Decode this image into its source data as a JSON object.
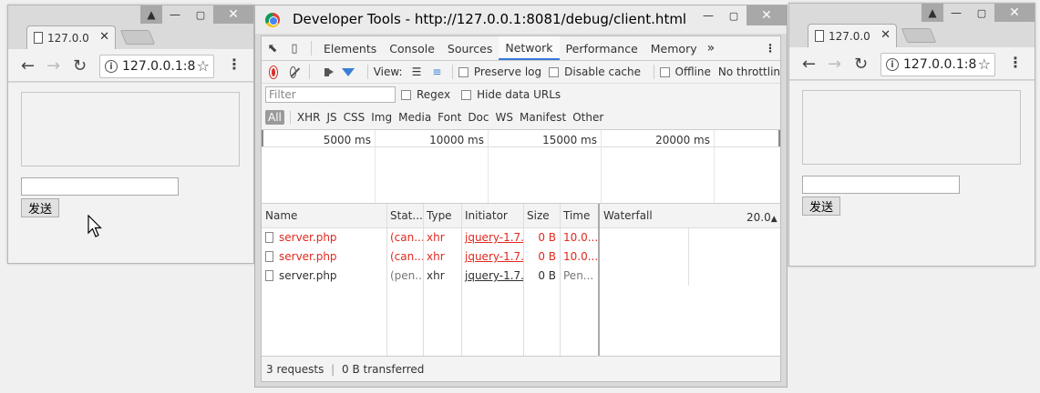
{
  "left_window": {
    "tab_title": "127.0.0",
    "omnibox_url": "127.0.0.1:8",
    "send_button": "发送",
    "message_input": ""
  },
  "right_window": {
    "tab_title": "127.0.0",
    "omnibox_url": "127.0.0.1:8",
    "send_button": "发送",
    "message_input": ""
  },
  "devtools": {
    "window_title": "Developer Tools - http://127.0.0.1:8081/debug/client.html",
    "tabs": [
      "Elements",
      "Console",
      "Sources",
      "Network",
      "Performance",
      "Memory"
    ],
    "active_tab": "Network",
    "more_tabs": "»",
    "toolbar": {
      "view_label": "View:",
      "preserve_log": "Preserve log",
      "disable_cache": "Disable cache",
      "offline": "Offline",
      "throttling": "No throttlin"
    },
    "filter": {
      "placeholder": "Filter",
      "regex": "Regex",
      "hide_data_urls": "Hide data URLs"
    },
    "types": [
      "All",
      "XHR",
      "JS",
      "CSS",
      "Img",
      "Media",
      "Font",
      "Doc",
      "WS",
      "Manifest",
      "Other"
    ],
    "timeline_ticks": [
      "5000 ms",
      "10000 ms",
      "15000 ms",
      "20000 ms"
    ],
    "columns": {
      "name": "Name",
      "status": "Stat...",
      "type": "Type",
      "initiator": "Initiator",
      "size": "Size",
      "time": "Time",
      "waterfall": "Waterfall",
      "waterfall_scale": "20.0"
    },
    "requests": [
      {
        "name": "server.php",
        "status": "(can...",
        "type": "xhr",
        "initiator": "jquery-1.7...",
        "size": "0 B",
        "time": "10.0...",
        "failed": true
      },
      {
        "name": "server.php",
        "status": "(can...",
        "type": "xhr",
        "initiator": "jquery-1.7...",
        "size": "0 B",
        "time": "10.0...",
        "failed": true
      },
      {
        "name": "server.php",
        "status": "(pen...",
        "type": "xhr",
        "initiator": "jquery-1.7...",
        "size": "0 B",
        "time": "Pen...",
        "failed": false
      }
    ],
    "status_bar": {
      "requests": "3 requests",
      "separator": "|",
      "transferred": "0 B transferred"
    }
  },
  "colors": {
    "record": "#d93025",
    "active_tab_underline": "#3879d9",
    "error_text": "#e0291e",
    "filter_icon": "#3a7fd4"
  }
}
